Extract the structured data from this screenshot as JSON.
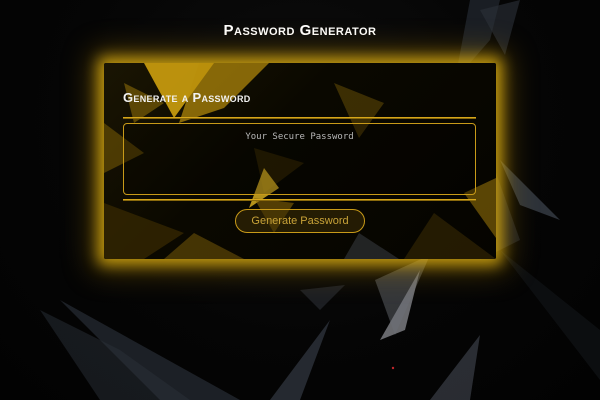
{
  "page": {
    "title": "Password Generator"
  },
  "card": {
    "heading": "Generate a Password",
    "output_placeholder": "Your Secure Password",
    "output_value": "",
    "generate_label": "Generate Password"
  },
  "colors": {
    "accent_gold": "#e8b814",
    "background": "#040404",
    "text": "#ffffff"
  }
}
